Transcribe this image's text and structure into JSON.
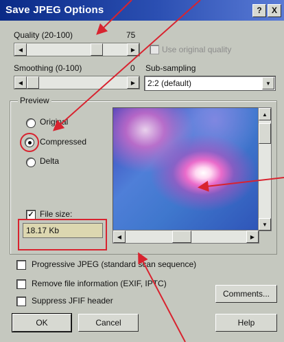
{
  "dialog": {
    "title": "Save JPEG Options",
    "help_button": "?",
    "close_button": "X"
  },
  "quality": {
    "label": "Quality (20-100)",
    "value": "75",
    "slider_level": 0.73,
    "use_original_label": "Use original quality",
    "use_original_checked": false
  },
  "smoothing": {
    "label": "Smoothing (0-100)",
    "value": "0",
    "slider_level": 0.0
  },
  "subsampling": {
    "label": "Sub-sampling",
    "selected": "2:2 (default)"
  },
  "preview": {
    "group_label": "Preview",
    "options": [
      "Original",
      "Compressed",
      "Delta"
    ],
    "selected_index": 1,
    "file_size_label": "File size:",
    "file_size_checked": true,
    "file_size_value": "18.17 Kb"
  },
  "options": {
    "progressive_label": "Progressive JPEG (standard scan sequence)",
    "remove_info_label": "Remove file information (EXIF, IPTC)",
    "suppress_jfif_label": "Suppress JFIF header"
  },
  "buttons": {
    "comments": "Comments...",
    "ok": "OK",
    "cancel": "Cancel",
    "help": "Help"
  },
  "colors": {
    "annotation": "#d8232f",
    "titlebar": "#0a2a86"
  }
}
